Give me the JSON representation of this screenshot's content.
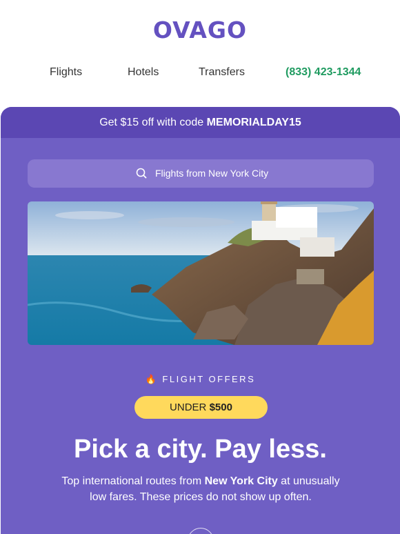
{
  "brand": {
    "logo_text": "OVAGO"
  },
  "nav": {
    "items": [
      {
        "label": "Flights"
      },
      {
        "label": "Hotels"
      },
      {
        "label": "Transfers"
      }
    ],
    "phone": "(833) 423-1344"
  },
  "promo": {
    "prefix": "Get $15 off with code ",
    "code": "MEMORIALDAY15"
  },
  "search": {
    "text": "Flights from New York City",
    "icon": "search-icon"
  },
  "hero": {
    "image": "coastal-cliffs-lighthouse"
  },
  "offers": {
    "icon": "fire-icon",
    "eyebrow": "FLIGHT OFFERS",
    "badge_prefix": "UNDER ",
    "badge_amount": "$500"
  },
  "headline": "Pick a city. Pay less.",
  "subtext": {
    "part1": "Top international routes from ",
    "city": "New York City",
    "part2": " at unusually low fares. These prices do not show up often."
  },
  "colors": {
    "brand": "#6451c0",
    "card": "#6f5fc4",
    "promo_bar": "#5b47b3",
    "phone": "#1f9b60",
    "badge": "#ffd95c"
  }
}
